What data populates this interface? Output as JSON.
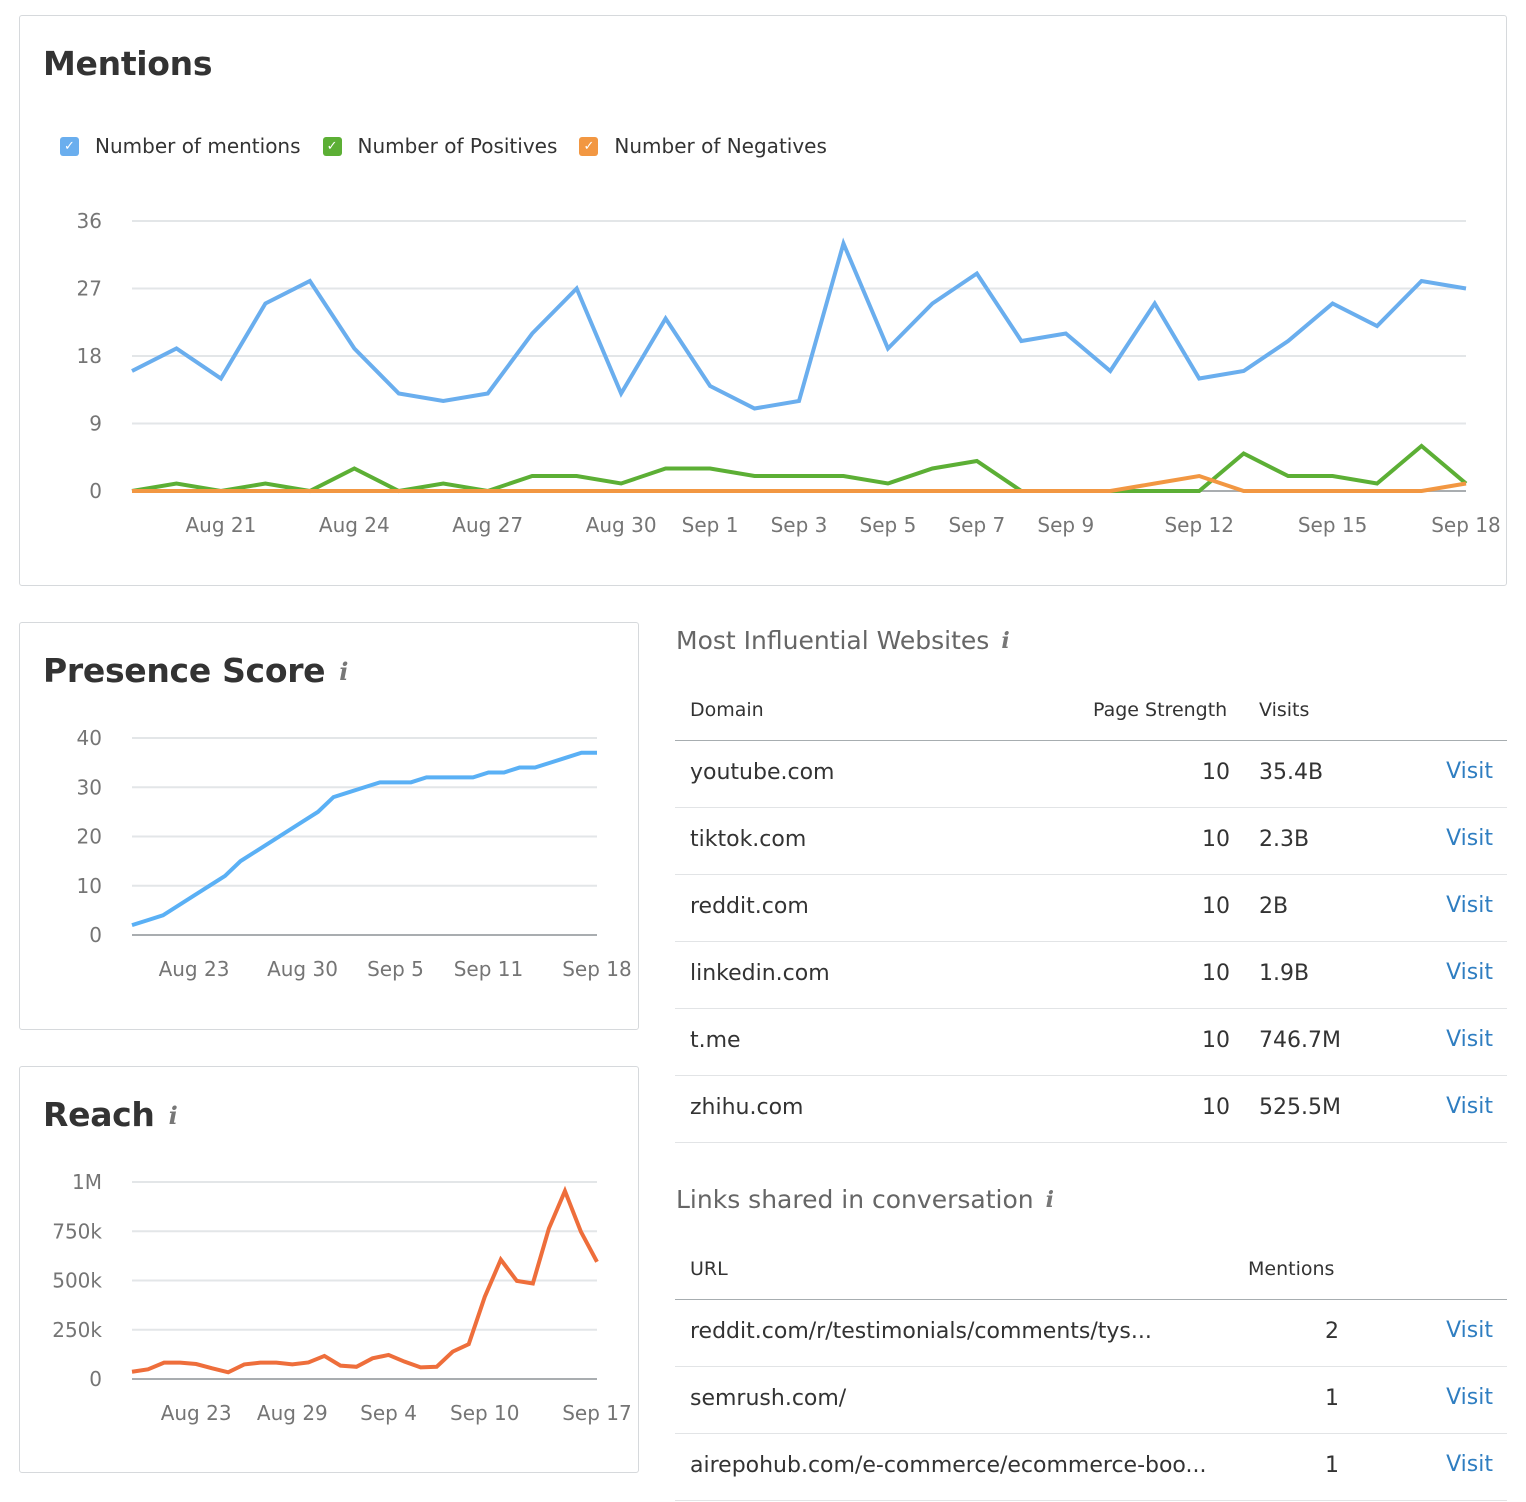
{
  "mentions": {
    "title": "Mentions",
    "legend": [
      {
        "label": "Number of mentions",
        "color": "#6aaeee",
        "checked": true
      },
      {
        "label": "Number of Positives",
        "color": "#5caf35",
        "checked": true
      },
      {
        "label": "Number of Negatives",
        "color": "#f29742",
        "checked": true
      }
    ]
  },
  "presence": {
    "title": "Presence Score",
    "info_icon": "i"
  },
  "reach": {
    "title": "Reach",
    "info_icon": "i"
  },
  "influential": {
    "title": "Most Influential Websites",
    "info_icon": "i",
    "columns": [
      "Domain",
      "Page Strength",
      "Visits"
    ],
    "rows": [
      {
        "domain": "youtube.com",
        "strength": "10",
        "visits": "35.4B",
        "action": "Visit"
      },
      {
        "domain": "tiktok.com",
        "strength": "10",
        "visits": "2.3B",
        "action": "Visit"
      },
      {
        "domain": "reddit.com",
        "strength": "10",
        "visits": "2B",
        "action": "Visit"
      },
      {
        "domain": "linkedin.com",
        "strength": "10",
        "visits": "1.9B",
        "action": "Visit"
      },
      {
        "domain": "t.me",
        "strength": "10",
        "visits": "746.7M",
        "action": "Visit"
      },
      {
        "domain": "zhihu.com",
        "strength": "10",
        "visits": "525.5M",
        "action": "Visit"
      }
    ]
  },
  "links": {
    "title": "Links shared in conversation",
    "info_icon": "i",
    "columns": [
      "URL",
      "Mentions"
    ],
    "rows": [
      {
        "url": "reddit.com/r/testimonials/comments/tys...",
        "mentions": "2",
        "action": "Visit"
      },
      {
        "url": "semrush.com/",
        "mentions": "1",
        "action": "Visit"
      },
      {
        "url": "airepohub.com/e-commerce/ecommerce-boo...",
        "mentions": "1",
        "action": "Visit"
      }
    ]
  },
  "chart_data": [
    {
      "id": "mentions",
      "type": "line",
      "title": "Mentions",
      "x": [
        "Aug 19",
        "Aug 20",
        "Aug 21",
        "Aug 22",
        "Aug 23",
        "Aug 24",
        "Aug 25",
        "Aug 26",
        "Aug 27",
        "Aug 28",
        "Aug 29",
        "Aug 30",
        "Aug 31",
        "Sep 1",
        "Sep 2",
        "Sep 3",
        "Sep 4",
        "Sep 5",
        "Sep 6",
        "Sep 7",
        "Sep 8",
        "Sep 9",
        "Sep 10",
        "Sep 11",
        "Sep 12",
        "Sep 13",
        "Sep 14",
        "Sep 15",
        "Sep 16",
        "Sep 17",
        "Sep 18"
      ],
      "x_tick_labels": [
        "Aug 21",
        "Aug 24",
        "Aug 27",
        "Aug 30",
        "Sep 1",
        "Sep 3",
        "Sep 5",
        "Sep 7",
        "Sep 9",
        "Sep 12",
        "Sep 15",
        "Sep 18"
      ],
      "y_ticks": [
        0,
        9,
        18,
        27,
        36
      ],
      "ylim": [
        0,
        36
      ],
      "grid": true,
      "legend": "top-left",
      "series": [
        {
          "name": "Number of mentions",
          "color": "#6aaeee",
          "values": [
            16,
            19,
            15,
            25,
            28,
            19,
            13,
            12,
            13,
            21,
            27,
            13,
            23,
            14,
            11,
            12,
            33,
            19,
            25,
            29,
            20,
            21,
            16,
            25,
            15,
            16,
            20,
            25,
            22,
            28,
            27
          ]
        },
        {
          "name": "Number of Positives",
          "color": "#5caf35",
          "values": [
            0,
            1,
            0,
            1,
            0,
            3,
            0,
            1,
            0,
            2,
            2,
            1,
            3,
            3,
            2,
            2,
            2,
            1,
            3,
            4,
            0,
            0,
            0,
            0,
            0,
            5,
            2,
            2,
            1,
            6,
            1
          ]
        },
        {
          "name": "Number of Negatives",
          "color": "#f29742",
          "values": [
            0,
            0,
            0,
            0,
            0,
            0,
            0,
            0,
            0,
            0,
            0,
            0,
            0,
            0,
            0,
            0,
            0,
            0,
            0,
            0,
            0,
            0,
            0,
            1,
            2,
            0,
            0,
            0,
            0,
            0,
            1
          ]
        }
      ]
    },
    {
      "id": "presence",
      "type": "line",
      "title": "Presence Score",
      "x": [
        "Aug 19",
        "Aug 20",
        "Aug 21",
        "Aug 22",
        "Aug 23",
        "Aug 24",
        "Aug 25",
        "Aug 26",
        "Aug 27",
        "Aug 28",
        "Aug 29",
        "Aug 30",
        "Aug 31",
        "Sep 1",
        "Sep 2",
        "Sep 3",
        "Sep 4",
        "Sep 5",
        "Sep 6",
        "Sep 7",
        "Sep 8",
        "Sep 9",
        "Sep 10",
        "Sep 11",
        "Sep 12",
        "Sep 13",
        "Sep 14",
        "Sep 15",
        "Sep 16",
        "Sep 17",
        "Sep 18"
      ],
      "x_tick_labels": [
        "Aug 23",
        "Aug 30",
        "Sep 5",
        "Sep 11",
        "Sep 18"
      ],
      "y_ticks": [
        0,
        10,
        20,
        30,
        40
      ],
      "ylim": [
        0,
        40
      ],
      "grid": true,
      "series": [
        {
          "name": "Presence Score",
          "color": "#5ab0f5",
          "values": [
            2,
            3,
            4,
            6,
            8,
            10,
            12,
            15,
            17,
            19,
            21,
            23,
            25,
            28,
            29,
            30,
            31,
            31,
            31,
            32,
            32,
            32,
            32,
            33,
            33,
            34,
            34,
            35,
            36,
            37,
            37
          ]
        }
      ]
    },
    {
      "id": "reach",
      "type": "line",
      "title": "Reach",
      "x": [
        "Aug 19",
        "Aug 20",
        "Aug 21",
        "Aug 22",
        "Aug 23",
        "Aug 24",
        "Aug 25",
        "Aug 26",
        "Aug 27",
        "Aug 28",
        "Aug 29",
        "Aug 30",
        "Aug 31",
        "Sep 1",
        "Sep 2",
        "Sep 3",
        "Sep 4",
        "Sep 5",
        "Sep 6",
        "Sep 7",
        "Sep 8",
        "Sep 9",
        "Sep 10",
        "Sep 11",
        "Sep 12",
        "Sep 13",
        "Sep 14",
        "Sep 15",
        "Sep 16",
        "Sep 17"
      ],
      "x_tick_labels": [
        "Aug 23",
        "Aug 29",
        "Sep 4",
        "Sep 10",
        "Sep 17"
      ],
      "y_ticks": [
        0,
        250000,
        500000,
        750000,
        1000000
      ],
      "y_tick_labels": [
        "0",
        "250k",
        "500k",
        "750k",
        "1M"
      ],
      "ylim": [
        0,
        1000000
      ],
      "grid": true,
      "series": [
        {
          "name": "Reach",
          "color": "#ee6e3b",
          "values": [
            37000,
            49000,
            83000,
            83000,
            76000,
            54000,
            34000,
            74000,
            83000,
            83000,
            74000,
            84000,
            117000,
            68000,
            62000,
            105000,
            122000,
            88000,
            59000,
            62000,
            139000,
            177000,
            417000,
            606000,
            498000,
            485000,
            764000,
            954000,
            747000,
            595000
          ]
        }
      ]
    }
  ]
}
